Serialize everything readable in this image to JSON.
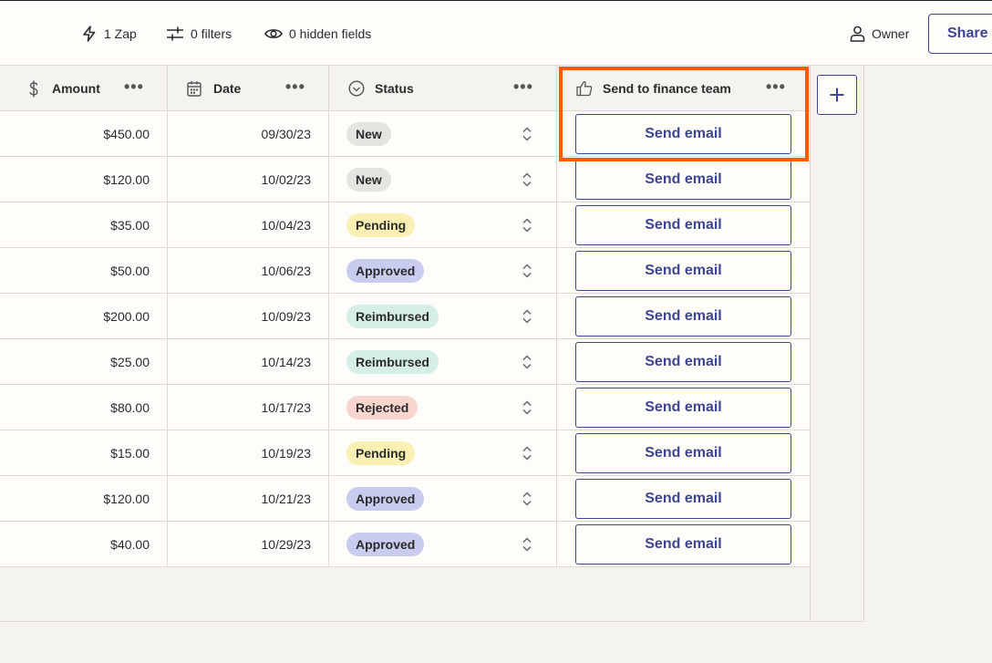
{
  "toolbar": {
    "zap_label": "1 Zap",
    "filters_label": "0 filters",
    "hidden_fields_label": "0 hidden fields",
    "owner_label": "Owner",
    "share_label": "Share"
  },
  "columns": {
    "amount": {
      "label": "Amount",
      "icon": "dollar-icon"
    },
    "date": {
      "label": "Date",
      "icon": "calendar-icon"
    },
    "status": {
      "label": "Status",
      "icon": "status-circle-check-icon"
    },
    "send": {
      "label": "Send to finance team",
      "icon": "thumbs-up-icon"
    },
    "more_label": "•••"
  },
  "rows": [
    {
      "amount": "$450.00",
      "date": "09/30/23",
      "status": "New",
      "action": "Send email"
    },
    {
      "amount": "$120.00",
      "date": "10/02/23",
      "status": "New",
      "action": "Send email"
    },
    {
      "amount": "$35.00",
      "date": "10/04/23",
      "status": "Pending",
      "action": "Send email"
    },
    {
      "amount": "$50.00",
      "date": "10/06/23",
      "status": "Approved",
      "action": "Send email"
    },
    {
      "amount": "$200.00",
      "date": "10/09/23",
      "status": "Reimbursed",
      "action": "Send email"
    },
    {
      "amount": "$25.00",
      "date": "10/14/23",
      "status": "Reimbursed",
      "action": "Send email"
    },
    {
      "amount": "$80.00",
      "date": "10/17/23",
      "status": "Rejected",
      "action": "Send email"
    },
    {
      "amount": "$15.00",
      "date": "10/19/23",
      "status": "Pending",
      "action": "Send email"
    },
    {
      "amount": "$120.00",
      "date": "10/21/23",
      "status": "Approved",
      "action": "Send email"
    },
    {
      "amount": "$40.00",
      "date": "10/29/23",
      "status": "Approved",
      "action": "Send email"
    }
  ],
  "status_colors": {
    "New": "#e6e4df",
    "Pending": "#fbf0b3",
    "Approved": "#c9ccef",
    "Reimbursed": "#d5efe4",
    "Rejected": "#f9d5d0"
  },
  "colors": {
    "accent": "#3d4592",
    "highlight": "#ff5a00",
    "border": "#dedad2",
    "background": "#f5f3ef"
  },
  "add_column_icon": "plus-icon"
}
